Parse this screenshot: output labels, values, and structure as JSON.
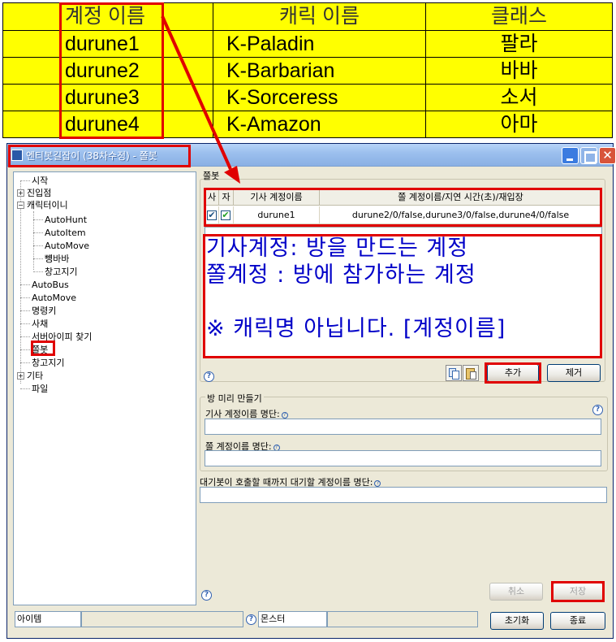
{
  "account_table": {
    "headers": [
      "계정 이름",
      "캐릭 이름",
      "클래스"
    ],
    "rows": [
      [
        "durune1",
        "K-Paladin",
        "팔라"
      ],
      [
        "durune2",
        "K-Barbarian",
        "바바"
      ],
      [
        "durune3",
        "K-Sorceress",
        "소서"
      ],
      [
        "durune4",
        "K-Amazon",
        "아마"
      ]
    ]
  },
  "window": {
    "title": "엔티봇길잡이 (38차수정) - 쫄봇",
    "close_glyph": "✕"
  },
  "tree": {
    "items": [
      {
        "label": "시작",
        "level": 0,
        "expander": ""
      },
      {
        "label": "진입점",
        "level": 0,
        "expander": "+"
      },
      {
        "label": "캐릭터이니",
        "level": 0,
        "expander": "−"
      },
      {
        "label": "AutoHunt",
        "level": 1,
        "expander": ""
      },
      {
        "label": "AutoItem",
        "level": 1,
        "expander": ""
      },
      {
        "label": "AutoMove",
        "level": 1,
        "expander": ""
      },
      {
        "label": "뻉바바",
        "level": 1,
        "expander": ""
      },
      {
        "label": "창고지기",
        "level": 1,
        "expander": ""
      },
      {
        "label": "AutoBus",
        "level": 0,
        "expander": ""
      },
      {
        "label": "AutoMove",
        "level": 0,
        "expander": ""
      },
      {
        "label": "명령키",
        "level": 0,
        "expander": ""
      },
      {
        "label": "사채",
        "level": 0,
        "expander": ""
      },
      {
        "label": "서버아이피 찾기",
        "level": 0,
        "expander": ""
      },
      {
        "label": "쫄봇",
        "level": 0,
        "expander": ""
      },
      {
        "label": "창고지기",
        "level": 0,
        "expander": ""
      },
      {
        "label": "기타",
        "level": 0,
        "expander": "+"
      },
      {
        "label": "파일",
        "level": 0,
        "expander": ""
      }
    ]
  },
  "zbot": {
    "group_label": "쫄봇",
    "columns": [
      "사",
      "자",
      "기사 계정이름",
      "쫄 계정이름/지연 시간(초)/재입장"
    ],
    "row": {
      "knight_checked": true,
      "auto_checked": true,
      "check_glyph": "✔",
      "knight_account": "durune1",
      "followers": "durune2/0/false,durune3/0/false,durune4/0/false"
    },
    "add_label": "추가",
    "remove_label": "제거"
  },
  "note": {
    "lines": [
      "기사계정: 방을 만드는 계정",
      "쫄계정 : 방에 참가하는 계정",
      "",
      "※ 캐릭명 아닙니다. [계정이름]"
    ]
  },
  "prebuild": {
    "group_label": "방 미리 만들기",
    "knight_list_label": "기사 계정이름 명단:",
    "knight_list_value": "",
    "follower_list_label": "쫄 계정이름 명단:",
    "follower_list_value": "",
    "wait_list_label": "대기봇이 호출할 때까지 대기할 계정이름 명단:",
    "wait_list_value": ""
  },
  "help_glyph": "?",
  "footer": {
    "cancel_label": "취소",
    "save_label": "저장",
    "reset_label": "초기화",
    "exit_label": "종료"
  },
  "status": {
    "item_label": "아이템",
    "item_value": "",
    "monster_label": "몬스터",
    "monster_value": ""
  },
  "colors": {
    "table_bg": "#ffff00",
    "highlight": "#e00000",
    "note_text": "#0000c8"
  }
}
